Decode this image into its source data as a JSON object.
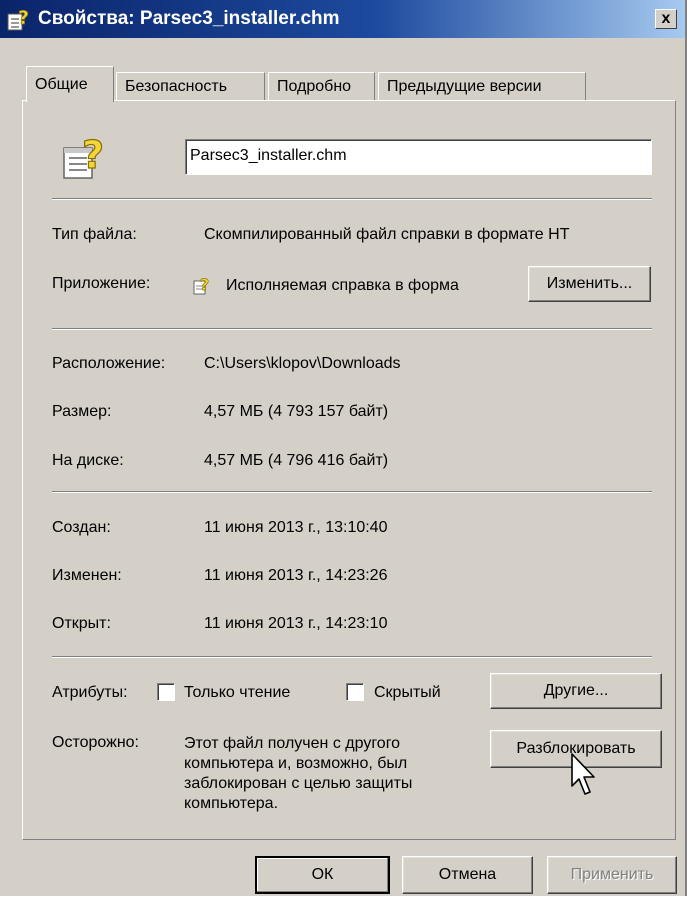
{
  "window": {
    "title": "Свойства: Parsec3_installer.chm",
    "close_label": "x"
  },
  "tabs": [
    {
      "label": "Общие",
      "active": true
    },
    {
      "label": "Безопасность",
      "active": false
    },
    {
      "label": "Подробно",
      "active": false
    },
    {
      "label": "Предыдущие версии",
      "active": false
    }
  ],
  "general": {
    "file_name": "Parsec3_installer.chm",
    "file_type_label": "Тип файла:",
    "file_type_value": "Скомпилированный файл справки в формате HT",
    "app_label": "Приложение:",
    "app_value": "Исполняемая справка в форма",
    "change_button": "Изменить...",
    "location_label": "Расположение:",
    "location_value": "C:\\Users\\klopov\\Downloads",
    "size_label": "Размер:",
    "size_value": "4,57 МБ (4 793 157 байт)",
    "disk_label": "На диске:",
    "disk_value": "4,57 МБ (4 796 416 байт)",
    "created_label": "Создан:",
    "created_value": "11 июня 2013 г., 13:10:40",
    "modified_label": "Изменен:",
    "modified_value": "11 июня 2013 г., 14:23:26",
    "opened_label": "Открыт:",
    "opened_value": "11 июня 2013 г., 14:23:10",
    "attributes_label": "Атрибуты:",
    "readonly_label": "Только чтение",
    "readonly_checked": false,
    "hidden_label": "Скрытый",
    "hidden_checked": false,
    "other_button": "Другие...",
    "caution_label": "Осторожно:",
    "caution_lines": [
      "Этот файл получен с другого",
      "компьютера и, возможно, был",
      "заблокирован с целью защиты",
      "компьютера."
    ],
    "unblock_button": "Разблокировать"
  },
  "footer": {
    "ok_button": "ОК",
    "cancel_button": "Отмена",
    "apply_button": "Применить"
  },
  "icons": {
    "title": "chm-help-file-icon",
    "file": "chm-help-file-icon",
    "app": "help-question-icon",
    "cursor": "mouse-pointer-icon"
  },
  "colors": {
    "titlebar_start": "#0a246a",
    "titlebar_end": "#a6caf0",
    "dialog_bg": "#d4d0c8",
    "icon_yellow": "#f2d53a"
  }
}
